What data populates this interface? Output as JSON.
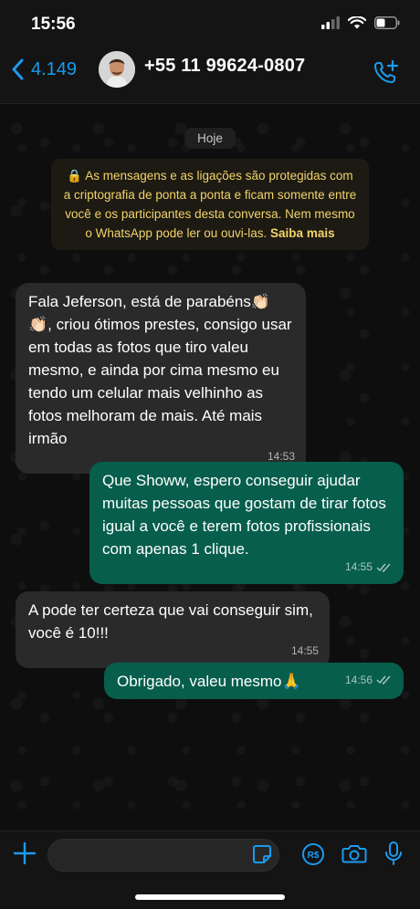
{
  "status": {
    "time": "15:56"
  },
  "header": {
    "back_label": "4.149",
    "contact_name": "+55 11 99624-0807"
  },
  "chat": {
    "date_chip": "Hoje",
    "encryption_text": "As mensagens e as ligações são protegidas com a criptografia de ponta a ponta e ficam somente entre você e os participantes desta conversa. Nem mesmo o WhatsApp pode ler ou ouvi-las.",
    "encryption_link": "Saiba mais",
    "messages": [
      {
        "direction": "in",
        "text": "Fala Jeferson, está de parabéns👏🏻👏🏻, criou ótimos prestes, consigo usar em todas as fotos que tiro valeu mesmo, e ainda por cima mesmo eu tendo um celular mais velhinho as fotos melhoram de mais. Até mais irmão",
        "time": "14:53"
      },
      {
        "direction": "out",
        "text": "Que Showw, espero conseguir ajudar muitas pessoas que gostam de tirar fotos igual a você e terem fotos profissionais com apenas 1 clique.",
        "time": "14:55"
      },
      {
        "direction": "in",
        "text": "A pode ter certeza que vai conseguir sim, você é 10!!!",
        "time": "14:55"
      },
      {
        "direction": "out",
        "text": "Obrigado, valeu mesmo🙏",
        "time": "14:56"
      }
    ]
  },
  "colors": {
    "accent": "#1a9bf0",
    "outgoing": "#075e4c",
    "incoming": "#2a2a2a",
    "notice": "#f3d36c"
  }
}
